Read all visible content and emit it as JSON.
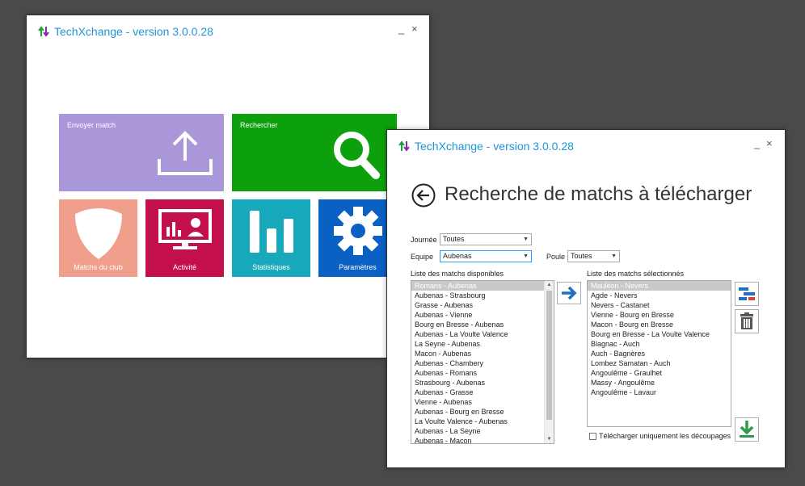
{
  "colors": {
    "accent": "#1f95d6",
    "tile_envoyer": "#a997d9",
    "tile_rechercher": "#0ca00c",
    "tile_matchs": "#ef9f8c",
    "tile_activite": "#c4104a",
    "tile_statistiques": "#18a9bd",
    "tile_parametres": "#0b60c4"
  },
  "main_window": {
    "title": "TechXchange - version 3.0.0.28",
    "minimize": "_",
    "close": "×",
    "tiles": {
      "envoyer": "Envoyer match",
      "rechercher": "Rechercher",
      "matchs_club": "Matchs du club",
      "activite": "Activité",
      "statistiques": "Statistiques",
      "parametres": "Paramètres"
    }
  },
  "search_window": {
    "title": "TechXchange - version 3.0.0.28",
    "minimize": "_",
    "close": "×",
    "page_title": "Recherche de matchs à télécharger",
    "journee": {
      "label": "Journée",
      "value": "Toutes"
    },
    "equipe": {
      "label": "Equipe",
      "value": "Aubenas"
    },
    "poule": {
      "label": "Poule",
      "value": "Toutes"
    },
    "available": {
      "label": "Liste des matchs disponibles",
      "items": [
        "Romans - Aubenas",
        "Aubenas - Strasbourg",
        "Grasse - Aubenas",
        "Aubenas - Vienne",
        "Bourg en Bresse - Aubenas",
        "Aubenas - La Voulte Valence",
        "La Seyne - Aubenas",
        "Macon - Aubenas",
        "Aubenas - Chambery",
        "Aubenas - Romans",
        "Strasbourg - Aubenas",
        "Aubenas - Grasse",
        "Vienne - Aubenas",
        "Aubenas - Bourg en Bresse",
        "La Voulte Valence - Aubenas",
        "Aubenas - La Seyne",
        "Aubenas - Macon"
      ]
    },
    "selected": {
      "label": "Liste des matchs sélectionnés",
      "items": [
        "Mauléon - Nevers",
        "Agde - Nevers",
        "Nevers - Castanet",
        "Vienne - Bourg en Bresse",
        "Macon - Bourg en Bresse",
        "Bourg en Bresse - La Voulte Valence",
        "Blagnac - Auch",
        "Auch - Bagnères",
        "Lombez Samatan - Auch",
        "Angoulême - Graulhet",
        "Massy - Angoulême",
        "Angoulême - Lavaur"
      ]
    },
    "checkbox_label": "Télécharger uniquement les découpages"
  }
}
